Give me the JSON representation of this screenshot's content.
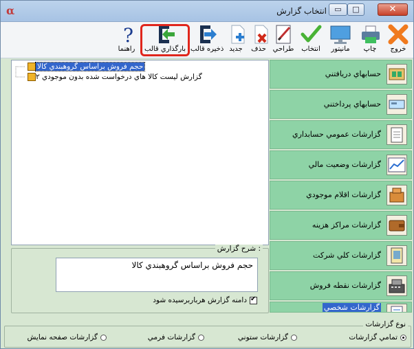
{
  "window": {
    "title": "انتخاب گزارش",
    "logo": "α"
  },
  "toolbar": {
    "buttons": [
      {
        "label": "راهنما",
        "icon": "help-icon"
      },
      {
        "label": "بارگذاري قالب",
        "icon": "load-template-icon"
      },
      {
        "label": "ذخيره قالب",
        "icon": "save-template-icon"
      },
      {
        "label": "جديد",
        "icon": "new-icon"
      },
      {
        "label": "حذف",
        "icon": "delete-icon"
      },
      {
        "label": "طراحي",
        "icon": "design-icon"
      },
      {
        "label": "انتخاب",
        "icon": "select-icon"
      },
      {
        "label": "مانيتور",
        "icon": "monitor-icon"
      },
      {
        "label": "چاپ",
        "icon": "print-icon"
      },
      {
        "label": "خروج",
        "icon": "exit-icon"
      }
    ]
  },
  "tree": {
    "items": [
      {
        "label": "حجم فروش براساس گروهبندي كالا",
        "selected": true
      },
      {
        "label": "گزارش ليست كالا هاي درخواست شده بدون موجودي ۲",
        "selected": false
      }
    ]
  },
  "description": {
    "legend": "شرح گزارش :",
    "text": "حجم فروش براساس گروهبندي كالا",
    "checkbox_label": "دامنه گزارش هرباربرسيده شود",
    "checkbox_checked": true
  },
  "categories": [
    {
      "label": "حسابهاي دريافتني",
      "icon": "receivables-icon"
    },
    {
      "label": "حسابهاي پرداختني",
      "icon": "payables-icon"
    },
    {
      "label": "گزارشات عمومي حسابداري",
      "icon": "accounting-reports-icon"
    },
    {
      "label": "گزارشات وضعيت مالي",
      "icon": "financial-status-icon"
    },
    {
      "label": "گزارشات اقلام موجودي",
      "icon": "inventory-icon"
    },
    {
      "label": "گزارشات مراكز هزينه",
      "icon": "cost-centers-icon"
    },
    {
      "label": "گزارشات كلي شركت",
      "icon": "company-reports-icon"
    },
    {
      "label": "گزارشات نقطه فروش",
      "icon": "pos-icon"
    },
    {
      "label": "گزارشات شخصي",
      "icon": "personal-reports-icon",
      "selected": true
    }
  ],
  "report_type": {
    "legend": "نوع گزارشات",
    "options": [
      {
        "label": "تمامي گزارشات",
        "checked": true
      },
      {
        "label": "گزارشات ستوني",
        "checked": false
      },
      {
        "label": "گزارشات فرمي",
        "checked": false
      },
      {
        "label": "گزارشات صفحه نمايش",
        "checked": false
      }
    ]
  }
}
